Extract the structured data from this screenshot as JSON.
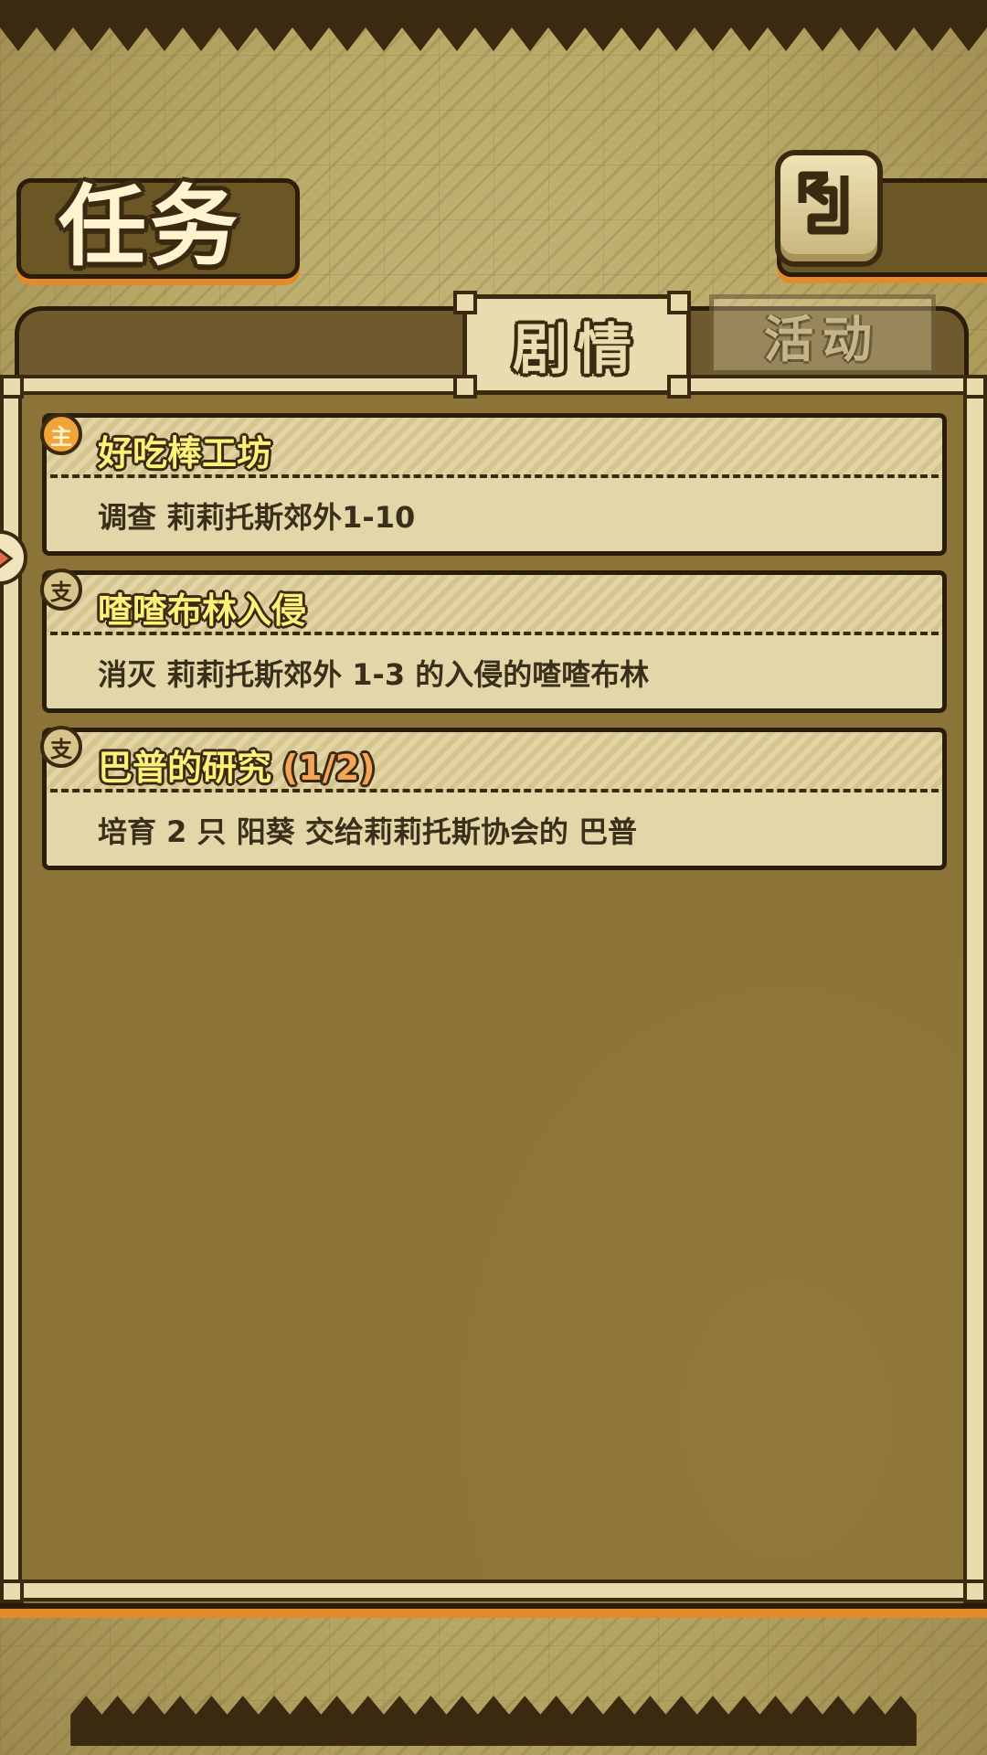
{
  "header": {
    "title": "任务",
    "back_icon": "back-return-icon"
  },
  "tabs": [
    {
      "label": "剧情",
      "active": true
    },
    {
      "label": "活动",
      "active": false
    }
  ],
  "quests": [
    {
      "badge": "主",
      "title": "好吃棒工坊",
      "progress": "",
      "description": "调查 莉莉托斯郊外1-10"
    },
    {
      "badge": "支",
      "title": "喳喳布林入侵",
      "progress": "",
      "description": "消灭 莉莉托斯郊外 1-3 的入侵的喳喳布林"
    },
    {
      "badge": "支",
      "title": "巴普的研究",
      "progress": "(1/2)",
      "description": "培育 2 只 阳葵 交给莉莉托斯协会的 巴普"
    }
  ],
  "colors": {
    "accent_orange": "#e58a2a",
    "title_yellow": "#fff07a",
    "progress_orange": "#f5a55a",
    "panel_brown": "#8c7438"
  }
}
